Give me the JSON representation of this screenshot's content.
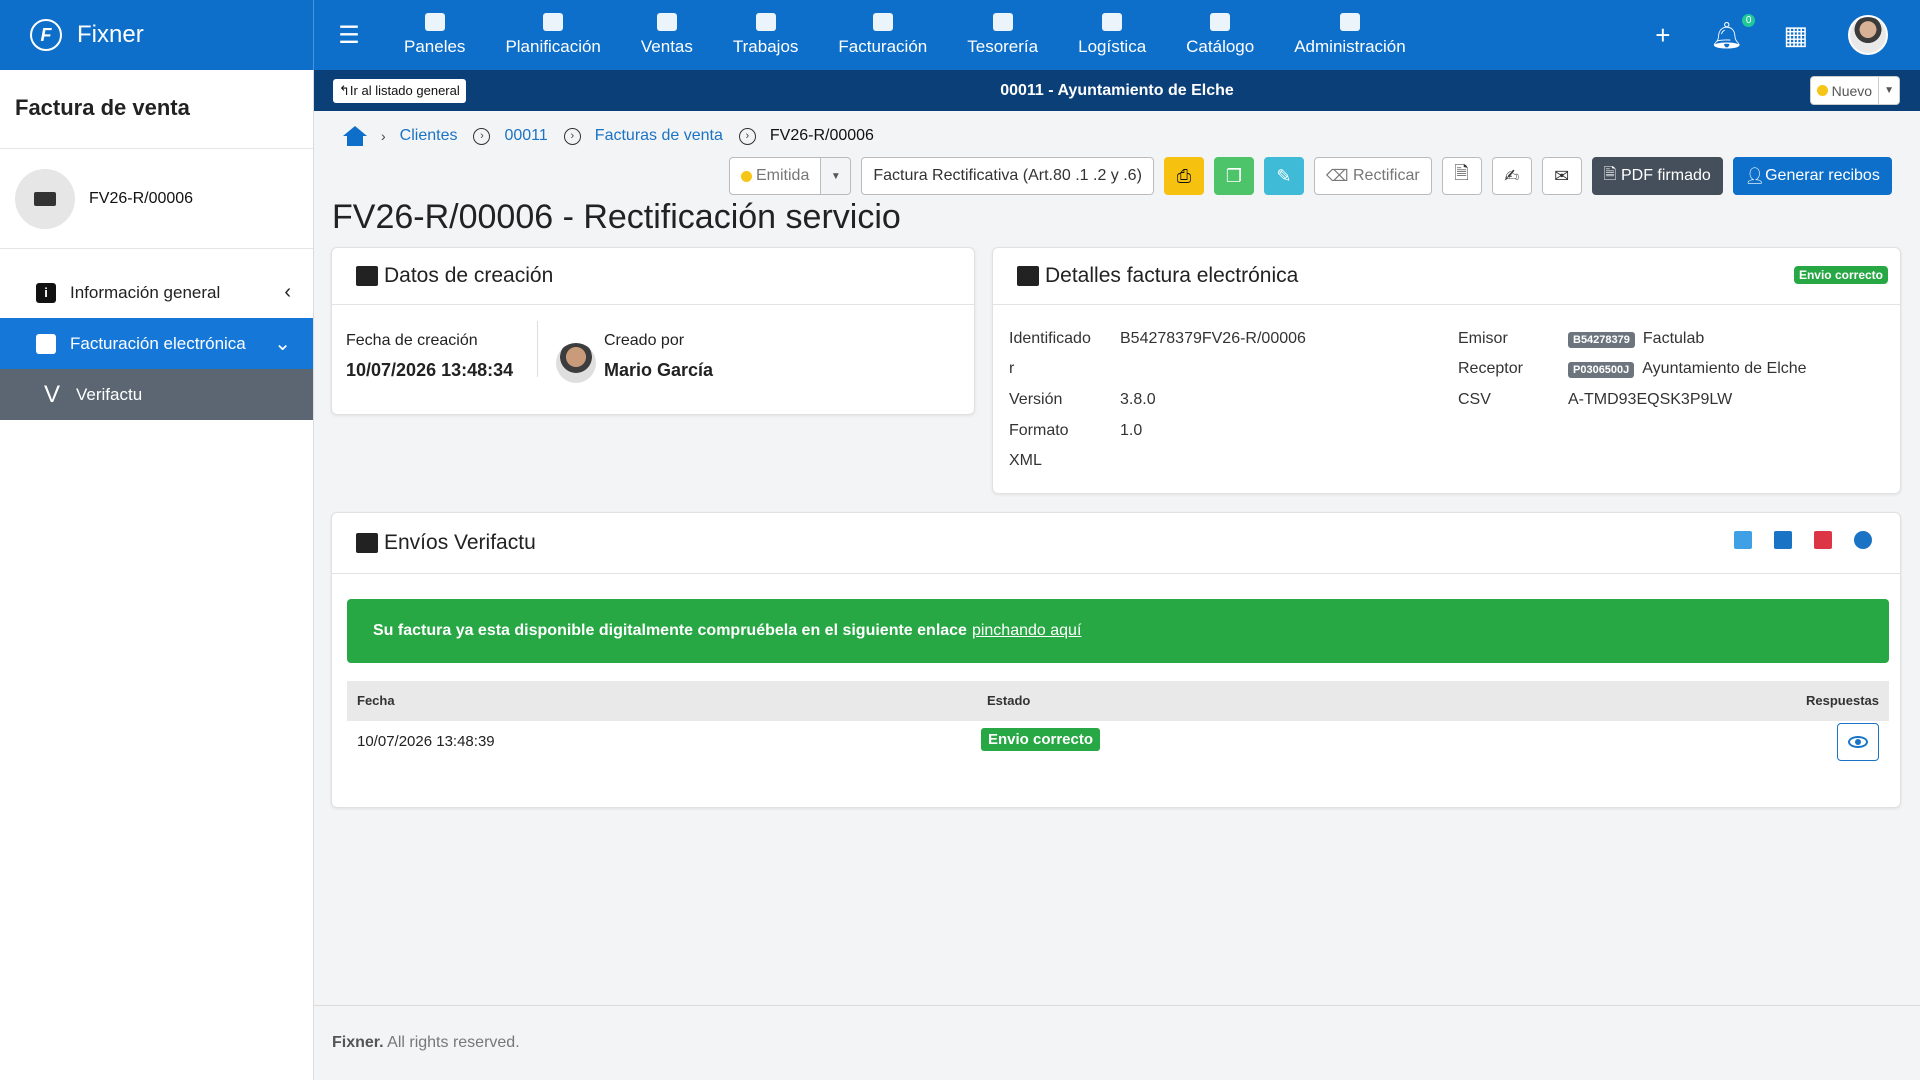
{
  "app": {
    "name": "Fixner",
    "logo_letter": "F"
  },
  "nav": [
    {
      "label": "Paneles",
      "icon": "dashboard-icon"
    },
    {
      "label": "Planificación",
      "icon": "calendar-icon"
    },
    {
      "label": "Ventas",
      "icon": "handshake-icon"
    },
    {
      "label": "Trabajos",
      "icon": "folder-open-icon"
    },
    {
      "label": "Facturación",
      "icon": "invoice-icon"
    },
    {
      "label": "Tesorería",
      "icon": "money-icon"
    },
    {
      "label": "Logística",
      "icon": "logistics-icon"
    },
    {
      "label": "Catálogo",
      "icon": "catalog-icon"
    },
    {
      "label": "Administración",
      "icon": "gear-icon"
    }
  ],
  "topright": {
    "plus": "+",
    "notifications_count": "0"
  },
  "subbar": {
    "back_label": "Ir al listado general",
    "title": "00011 - Ayuntamiento de Elche",
    "status_label": "Nuevo"
  },
  "sidebar": {
    "title": "Factura de venta",
    "doc_label": "FV26-R/00006",
    "menu": [
      {
        "label": "Información general",
        "icon": "info-icon"
      },
      {
        "label": "Facturación electrónica",
        "icon": "e-invoice-icon"
      },
      {
        "label": "Verifactu",
        "icon": "verifactu-icon",
        "icon_letter": "V"
      }
    ]
  },
  "breadcrumb": {
    "items": [
      "Clientes",
      "00011",
      "Facturas de venta"
    ],
    "current": "FV26-R/00006"
  },
  "toolbar": {
    "status": "Emitida",
    "type": "Factura Rectificativa (Art.80 .1 .2 y .6)",
    "rectificar": "Rectificar",
    "pdf_firmado": "PDF firmado",
    "generar_recibos": "Generar recibos"
  },
  "page_title": "FV26-R/00006 - Rectificación servicio",
  "creacion": {
    "title": "Datos de creación",
    "fecha_label": "Fecha de creación",
    "fecha_value": "10/07/2026 13:48:34",
    "creado_label": "Creado por",
    "creado_value": "Mario García"
  },
  "detalles": {
    "title": "Detalles factura electrónica",
    "badge": "Envio correcto",
    "identificador_label_1": "Identificado",
    "identificador_label_2": "r",
    "identificador_value": "B54278379FV26-R/00006",
    "version_label": "Versión",
    "version_value": "3.8.0",
    "formato_label_1": "Formato",
    "formato_label_2": "XML",
    "formato_value": "1.0",
    "emisor_label": "Emisor",
    "emisor_tag": "B54278379",
    "emisor_value": "Factulab",
    "receptor_label": "Receptor",
    "receptor_tag": "P0306500J",
    "receptor_value": "Ayuntamiento de Elche",
    "csv_label": "CSV",
    "csv_value": "A-TMD93EQSK3P9LW"
  },
  "envios": {
    "title": "Envíos Verifactu",
    "alert_text": "Su factura ya esta disponible digitalmente compruébela en el siguiente enlace",
    "alert_link": "pinchando aquí",
    "col_fecha": "Fecha",
    "col_estado": "Estado",
    "col_respuestas": "Respuestas",
    "rows": [
      {
        "fecha": "10/07/2026 13:48:39",
        "estado": "Envio correcto"
      }
    ]
  },
  "footer": {
    "brand": "Fixner.",
    "text": "All rights reserved."
  }
}
